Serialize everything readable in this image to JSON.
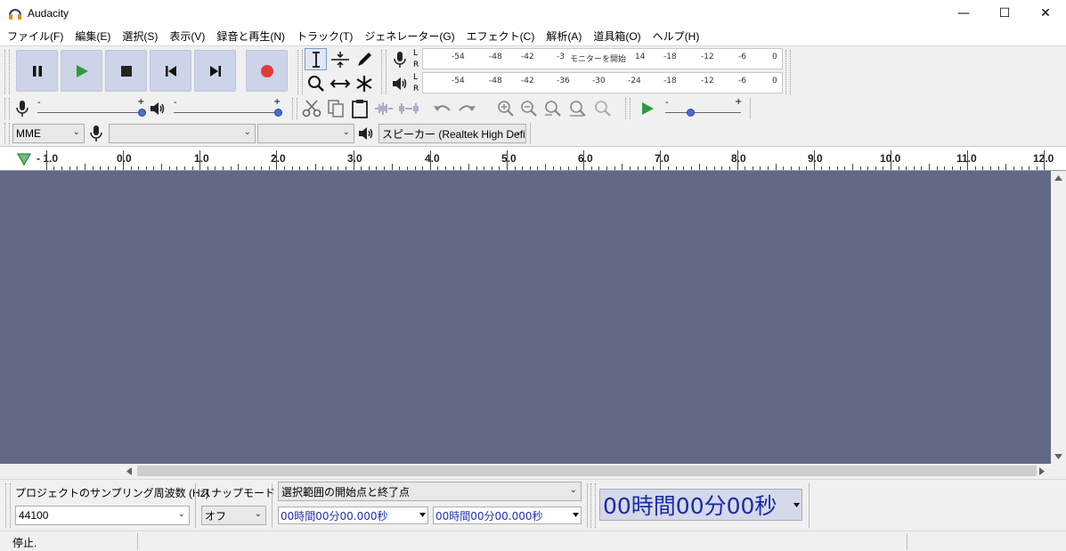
{
  "window": {
    "title": "Audacity"
  },
  "menu": [
    "ファイル(F)",
    "編集(E)",
    "選択(S)",
    "表示(V)",
    "録音と再生(N)",
    "トラック(T)",
    "ジェネレーター(G)",
    "エフェクト(C)",
    "解析(A)",
    "道具箱(O)",
    "ヘルプ(H)"
  ],
  "meters": {
    "record_ticks": [
      "-54",
      "-48",
      "-42",
      "-3",
      "モニターを開始",
      "14",
      "-18",
      "-12",
      "-6",
      "0"
    ],
    "play_ticks": [
      "-54",
      "-48",
      "-42",
      "-36",
      "-30",
      "-24",
      "-18",
      "-12",
      "-6",
      "0"
    ],
    "channel_l": "L",
    "channel_r": "R"
  },
  "mixer": {
    "minus": "-",
    "plus": "+"
  },
  "device": {
    "host": "MME",
    "recording_device": "",
    "channels": "",
    "playback_device": "スピーカー (Realtek High Defi"
  },
  "ruler": {
    "labels": [
      "- 1.0",
      "0.0",
      "1.0",
      "2.0",
      "3.0",
      "4.0",
      "5.0",
      "6.0",
      "7.0",
      "8.0",
      "9.0",
      "10.0",
      "11.0",
      "12.0"
    ]
  },
  "selection": {
    "rate_label": "プロジェクトのサンプリング周波数 (Hz)",
    "rate_value": "44100",
    "snap_label": "スナップモード",
    "snap_value": "オフ",
    "mode": "選択範囲の開始点と終了点",
    "start": "00時間00分00.000秒",
    "end": "00時間00分00.000秒"
  },
  "time": {
    "display": "00時間00分00秒"
  },
  "status": {
    "text": "停止."
  },
  "colors": {
    "canvas": "#636985",
    "play_green": "#2e9b3a",
    "record_red": "#e23b3b"
  }
}
